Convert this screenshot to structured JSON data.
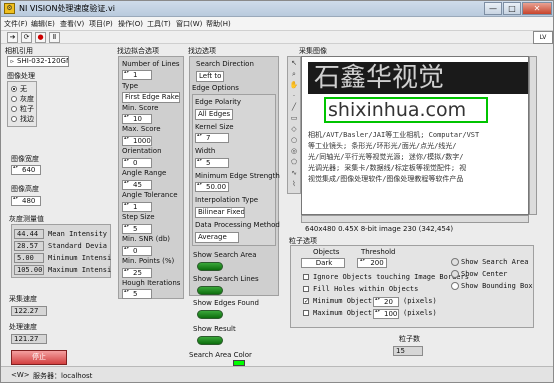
{
  "window": {
    "title": "NI VISION处理速度验证.vi"
  },
  "menu": [
    "文件(F)",
    "编辑(E)",
    "查看(V)",
    "项目(P)",
    "操作(O)",
    "工具(T)",
    "窗口(W)",
    "帮助(H)"
  ],
  "toolbar": {
    "run_icon": "run-arrow-icon",
    "run_continuous_icon": "run-continuous-icon",
    "abort_icon": "abort-icon",
    "pause_icon": "pause-icon"
  },
  "left": {
    "camera_label": "相机引用",
    "camera_value": "SHI-032-120GM",
    "processing_label": "图像处理",
    "processing_options": [
      "无",
      "灰度",
      "粒子",
      "找边"
    ],
    "processing_selected": 0,
    "width_label": "图像宽度",
    "width_value": "640",
    "height_label": "图像高度",
    "height_value": "480",
    "gray_label": "灰度测量值",
    "gray_rows": [
      {
        "value": "44.44",
        "name": "Mean Intensity"
      },
      {
        "value": "28.57",
        "name": "Standard Devia"
      },
      {
        "value": "5.00",
        "name": "Minimum Intensi"
      },
      {
        "value": "105.00",
        "name": "Maximum Intensi"
      }
    ],
    "acq_speed_label": "采集速度",
    "acq_speed_value": "122.27",
    "proc_speed_label": "处理速度",
    "proc_speed_value": "121.27",
    "stop_label": "停止"
  },
  "edge_settings": {
    "header": "找边拟合选项",
    "fields": [
      {
        "label": "Number of Lines",
        "value": "1"
      },
      {
        "label": "Type",
        "value": "First Edge Rake"
      },
      {
        "label": "Min. Score",
        "value": "10"
      },
      {
        "label": "Max. Score",
        "value": "1000"
      },
      {
        "label": "Orientation",
        "value": "0"
      },
      {
        "label": "Angle Range",
        "value": "45"
      },
      {
        "label": "Angle Tolerance",
        "value": "1"
      },
      {
        "label": "Step Size",
        "value": "5"
      },
      {
        "label": "Min. SNR (db)",
        "value": "0"
      },
      {
        "label": "Min. Points (%)",
        "value": "25"
      },
      {
        "label": "Hough Iterations",
        "value": "5"
      }
    ]
  },
  "find_options": {
    "header": "找边选项",
    "search_direction_label": "Search Direction",
    "search_direction_value": "Left to",
    "edge_options_label": "Edge Options",
    "fields": [
      {
        "label": "Edge Polarity",
        "value": "All Edges"
      },
      {
        "label": "Kernel Size",
        "value": "7"
      },
      {
        "label": "Width",
        "value": "5"
      },
      {
        "label": "Minimum Edge Strength",
        "value": "50.00"
      },
      {
        "label": "Interpolation Type",
        "value": "Bilinear Fixed"
      },
      {
        "label": "Data Processing Method",
        "value": "Average"
      }
    ],
    "toggles": [
      "Show Search Area",
      "Show Search Lines",
      "Show Edges Found",
      "Show Result"
    ],
    "color_label": "Search Area Color",
    "color_value": "#00ff00"
  },
  "image": {
    "header": "采集图像",
    "big_text": "石鑫华视觉",
    "url_text": "shixinhua.com",
    "text_lines": [
      "相机/AVT/Basler/JAI等工业相机; Computar/VST",
      "等工业镜头; 条形光/环形光/面光/点光/线光/",
      "光/同轴光/平行光等视觉光源; 迷你/模拟/数字/",
      "光调光器; 采集卡/数据线/标定板等视觉配件; 视",
      "视觉集成/图像处理软件/图像处理教程等软件产品"
    ],
    "status_text": "640x480 0.45X 8-bit image 230   (342,454)"
  },
  "particle": {
    "header": "粒子选项",
    "objects_label": "Objects",
    "objects_value": "Dark",
    "threshold_label": "Threshold",
    "threshold_value": "200",
    "ignore_label": "Ignore Objects touching Image Borders",
    "fill_label": "Fill Holes within Objects",
    "min_size_label": "Minimum Object Size",
    "min_size_value": "20",
    "max_size_label": "Maximum Object Size",
    "max_size_value": "100",
    "pixels_label": "(pixels)",
    "show_search_area": "Show Search Area",
    "show_center": "Show Center",
    "show_bounding_box": "Show Bounding Box",
    "count_label": "粒子数",
    "count_value": "15"
  },
  "statusbar": {
    "target": "<W>",
    "server_label": "服务器：localhost"
  }
}
